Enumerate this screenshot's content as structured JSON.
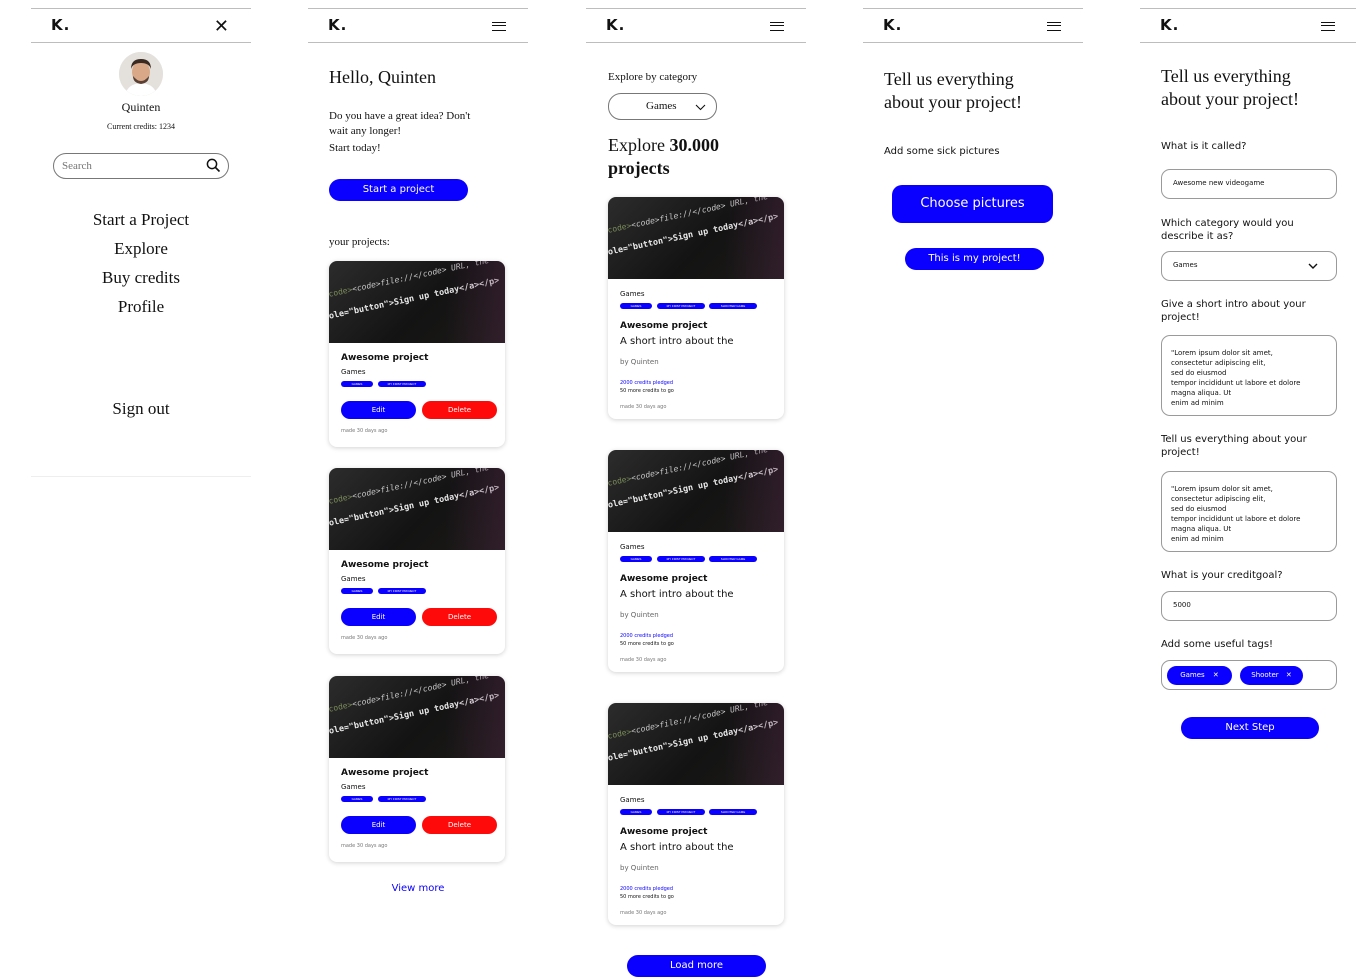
{
  "brand": {
    "logo": "K."
  },
  "menu_screen": {
    "user_name": "Quinten",
    "credits": "Current credits: 1234",
    "search_placeholder": "Search",
    "nav_items": [
      "Start a Project",
      "Explore",
      "Buy credits",
      "Profile"
    ],
    "sign_out": "Sign out"
  },
  "home_screen": {
    "greeting": "Hello, Quinten",
    "intro_line1": "Do you have a great idea? Don't",
    "intro_line2": "wait any longer!",
    "intro_line3": "Start today!",
    "start_button": "Start a project",
    "projects_heading": "your projects:",
    "projects": [
      {
        "title": "Awesome project",
        "category": "Games",
        "tags": [
          "GAMES",
          "MY FIRST PROJECT"
        ],
        "edit": "Edit",
        "delete": "Delete",
        "made": "made 30 days ago"
      },
      {
        "title": "Awesome project",
        "category": "Games",
        "tags": [
          "GAMES",
          "MY FIRST PROJECT"
        ],
        "edit": "Edit",
        "delete": "Delete",
        "made": "made 30 days ago"
      },
      {
        "title": "Awesome project",
        "category": "Games",
        "tags": [
          "GAMES",
          "MY FIRST PROJECT"
        ],
        "edit": "Edit",
        "delete": "Delete",
        "made": "made 30 days ago"
      }
    ],
    "view_more": "View more"
  },
  "explore_screen": {
    "label": "Explore by category",
    "category_selected": "Games",
    "heading_prefix": "Explore ",
    "heading_count": "30.000",
    "heading_suffix": "projects",
    "projects": [
      {
        "category": "Games",
        "tags": [
          "GAMES",
          "MY FIRST PROJECT",
          "SHOOTER GAME"
        ],
        "title": "Awesome project",
        "intro": "A short intro about the",
        "author": "by Quinten",
        "pledged": "2000 credits pledged",
        "togo": "50 more credits to go",
        "made": "made 30 days ago"
      },
      {
        "category": "Games",
        "tags": [
          "GAMES",
          "MY FIRST PROJECT",
          "SHOOTER GAME"
        ],
        "title": "Awesome project",
        "intro": "A short intro about the",
        "author": "by Quinten",
        "pledged": "2000 credits pledged",
        "togo": "50 more credits to go",
        "made": "made 30 days ago"
      },
      {
        "category": "Games",
        "tags": [
          "GAMES",
          "MY FIRST PROJECT",
          "SHOOTER GAME"
        ],
        "title": "Awesome project",
        "intro": "A short intro about the",
        "author": "by Quinten",
        "pledged": "2000 credits pledged",
        "togo": "50 more credits to go",
        "made": "made 30 days ago"
      }
    ],
    "load_more": "Load more"
  },
  "pictures_screen": {
    "title_line1": "Tell us everything",
    "title_line2": "about your project!",
    "label": "Add some sick pictures",
    "choose_button": "Choose pictures",
    "confirm_button": "This is my project!"
  },
  "form_screen": {
    "title_line1": "Tell us everything",
    "title_line2": "about your project!",
    "q_name": "What is it called?",
    "name_value": "Awesome new videogame",
    "q_category_line1": "Which category would you",
    "q_category_line2": "describe it as?",
    "category_value": "Games",
    "q_intro_line1": "Give a short intro about your",
    "q_intro_line2": "project!",
    "intro_text": [
      "\"Lorem ipsum dolor sit amet,",
      "consectetur adipiscing elit,",
      "sed do eiusmod",
      "tempor incididunt ut labore et dolore",
      "magna aliqua. Ut",
      "enim ad minim"
    ],
    "q_everything_line1": "Tell us everything about your",
    "q_everything_line2": "project!",
    "everything_text": [
      "\"Lorem ipsum dolor sit amet,",
      "consectetur adipiscing elit,",
      "sed do eiusmod",
      "tempor incididunt ut labore et dolore",
      "magna aliqua. Ut",
      "enim ad minim"
    ],
    "q_goal": "What is your creditgoal?",
    "goal_value": "5000",
    "q_tags": "Add some useful tags!",
    "tags": [
      "Games",
      "Shooter"
    ],
    "next_button": "Next Step"
  },
  "code_lines": {
    "line1": "<code>file://</code> URL, the",
    "line2": "role=\"button\">Sign up today</a></p>"
  },
  "icons": [
    "close-icon",
    "hamburger-icon",
    "search-icon",
    "chevron-down-icon",
    "tag-remove-icon"
  ],
  "colors": {
    "primary": "#0a00ff",
    "danger": "#ff0a0a",
    "text": "#111111"
  }
}
